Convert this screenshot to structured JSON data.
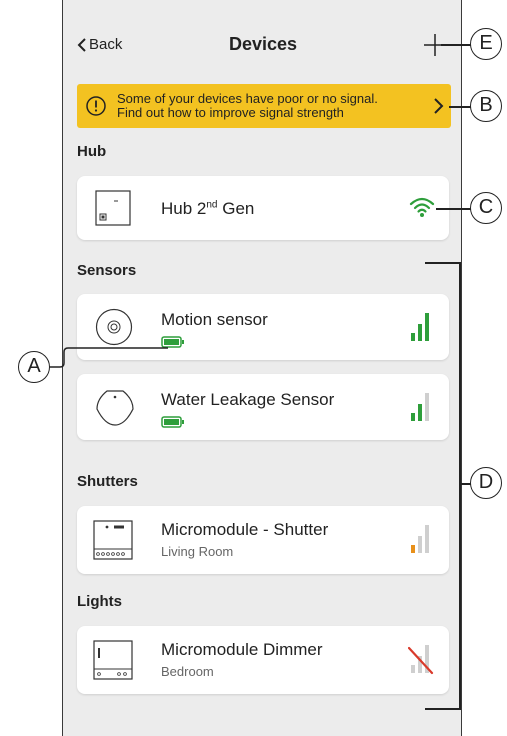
{
  "header": {
    "back_label": "Back",
    "title": "Devices"
  },
  "banner": {
    "line1": "Some of your devices have poor or no signal.",
    "line2": "Find out how to improve signal strength"
  },
  "sections": {
    "hub": "Hub",
    "sensors": "Sensors",
    "shutters": "Shutters",
    "lights": "Lights"
  },
  "devices": {
    "hub": {
      "name_base": "Hub 2",
      "name_sup": "nd",
      "name_end": " Gen",
      "signal": "wifi-strong"
    },
    "motion": {
      "name": "Motion sensor",
      "battery": "full",
      "signal_bars": 3
    },
    "water": {
      "name": "Water Leakage Sensor",
      "battery": "full",
      "signal_bars": 2
    },
    "shutter": {
      "name": "Micromodule - Shutter",
      "room": "Living Room",
      "signal_bars": 1
    },
    "dimmer": {
      "name": "Micromodule Dimmer",
      "room": "Bedroom",
      "signal_bars": 0
    }
  },
  "callouts": {
    "a": "A",
    "b": "B",
    "c": "C",
    "d": "D",
    "e": "E"
  },
  "colors": {
    "banner": "#f3c221",
    "signal_good": "#2e9e3b",
    "signal_low": "#e8901a",
    "no_signal": "#d93a2b",
    "inactive_bar": "#cfcfcf"
  }
}
